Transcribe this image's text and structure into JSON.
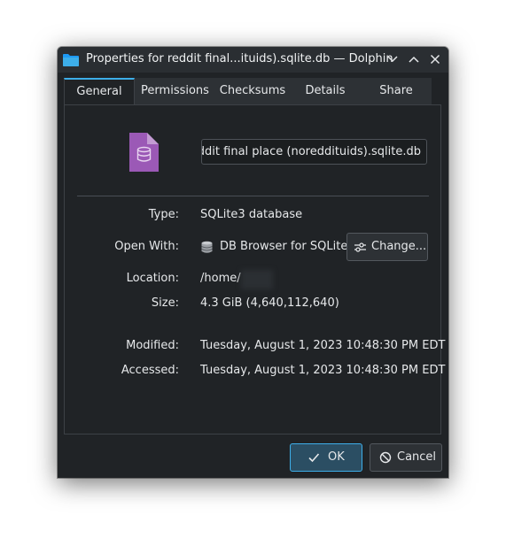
{
  "window": {
    "title": "Properties for reddit final...ituids).sqlite.db — Dolphin"
  },
  "tabs": [
    {
      "label": "General",
      "active": true
    },
    {
      "label": "Permissions",
      "active": false
    },
    {
      "label": "Checksums",
      "active": false
    },
    {
      "label": "Details",
      "active": false
    },
    {
      "label": "Share",
      "active": false
    }
  ],
  "general": {
    "filename": "reddit final place (noreddituids).sqlite.db",
    "type_label": "Type:",
    "type_value": "SQLite3 database",
    "open_with_label": "Open With:",
    "open_with_value": "DB Browser for SQLite",
    "change_label": "Change...",
    "location_label": "Location:",
    "location_value": "/home/",
    "size_label": "Size:",
    "size_value": "4.3 GiB (4,640,112,640)",
    "modified_label": "Modified:",
    "modified_value": "Tuesday, August 1, 2023 10:48:30 PM EDT",
    "accessed_label": "Accessed:",
    "accessed_value": "Tuesday, August 1, 2023 10:48:30 PM EDT"
  },
  "buttons": {
    "ok": "OK",
    "cancel": "Cancel"
  },
  "icons": {
    "app": "folder-icon",
    "file": "sqlite-database-file-icon",
    "open_with": "db-browser-icon",
    "change": "configure-icon",
    "ok": "checkmark-icon",
    "cancel": "cancel-icon",
    "minimize": "chevron-down-icon",
    "maximize": "chevron-up-icon",
    "close": "close-icon"
  },
  "colors": {
    "accent": "#3daee9",
    "background": "#202326",
    "file_icon": "#9b59b6"
  }
}
